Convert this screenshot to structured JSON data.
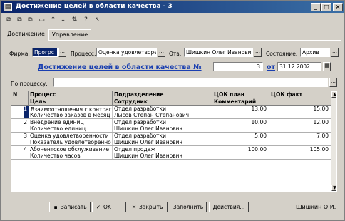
{
  "window": {
    "title": "Достижение целей в области качества - 3",
    "icon": "document-icon",
    "controls": [
      "_",
      "□",
      "×"
    ]
  },
  "toolbar": {
    "icons": [
      "copy-icon",
      "copy-icon",
      "copy-icon",
      "delete-icon",
      "move-up-icon",
      "move-down-icon",
      "sort-icon",
      "help-icon",
      "cursor-help-icon"
    ],
    "glyphs": [
      "⧉",
      "⧉",
      "⧉",
      "▭",
      "↑",
      "↓",
      "⇅",
      "?",
      "↖"
    ]
  },
  "tabs": [
    {
      "label": "Достижение",
      "active": true
    },
    {
      "label": "Управление",
      "active": false
    }
  ],
  "header": {
    "firm_label": "Фирма:",
    "firm_value": "Прогрс",
    "process_label": "Процесс:",
    "process_value": "Оценка удовлетворе",
    "responsible_label": "Отв:",
    "responsible_value": "Шишкин Олег Иванович",
    "state_label": "Состояние:",
    "state_value": "Архив",
    "doc_title": "Достижение целей в области качества №",
    "doc_number": "3",
    "date_label": "от",
    "date_value": "31.12.2002",
    "by_process_label": "По процессу:",
    "by_process_value": ""
  },
  "table": {
    "headers_top": [
      "N",
      "Процесс",
      "Подразделение",
      "ЦОК план",
      "ЦОК факт"
    ],
    "headers_bottom": [
      "Цель",
      "Сотрудник",
      "Комментарий"
    ],
    "rows": [
      {
        "n": "1",
        "process": "Взаимоотношения с контраг",
        "goal": "Количество заказов в месяц",
        "department": "Отдел разработки",
        "employee": "Лысов Степан Степанович",
        "plan": "13.00",
        "fact": "15.00"
      },
      {
        "n": "2",
        "process": "Внедрение единиц",
        "goal": "Количество единиц",
        "department": "Отдел разработки",
        "employee": "Шишкин Олег Иванович",
        "plan": "10.00",
        "fact": "12.00"
      },
      {
        "n": "3",
        "process": "Оценка удовлетворенности",
        "goal": "Показатель удовлетворенно",
        "department": "Отдел разработки",
        "employee": "Шишкин Олег Иванович",
        "plan": "5.00",
        "fact": "7.00"
      },
      {
        "n": "4",
        "process": "Абонентское обслуживание",
        "goal": "Количество часов",
        "department": "Отдел продаж",
        "employee": "Шишкин Олег Иванович",
        "plan": "100.00",
        "fact": "105.00"
      }
    ]
  },
  "buttons": {
    "save": "Записать",
    "ok": "OK",
    "close": "Закрыть",
    "fill": "Заполнить",
    "actions": "Действия..."
  },
  "status_user": "Шишкин О.И."
}
